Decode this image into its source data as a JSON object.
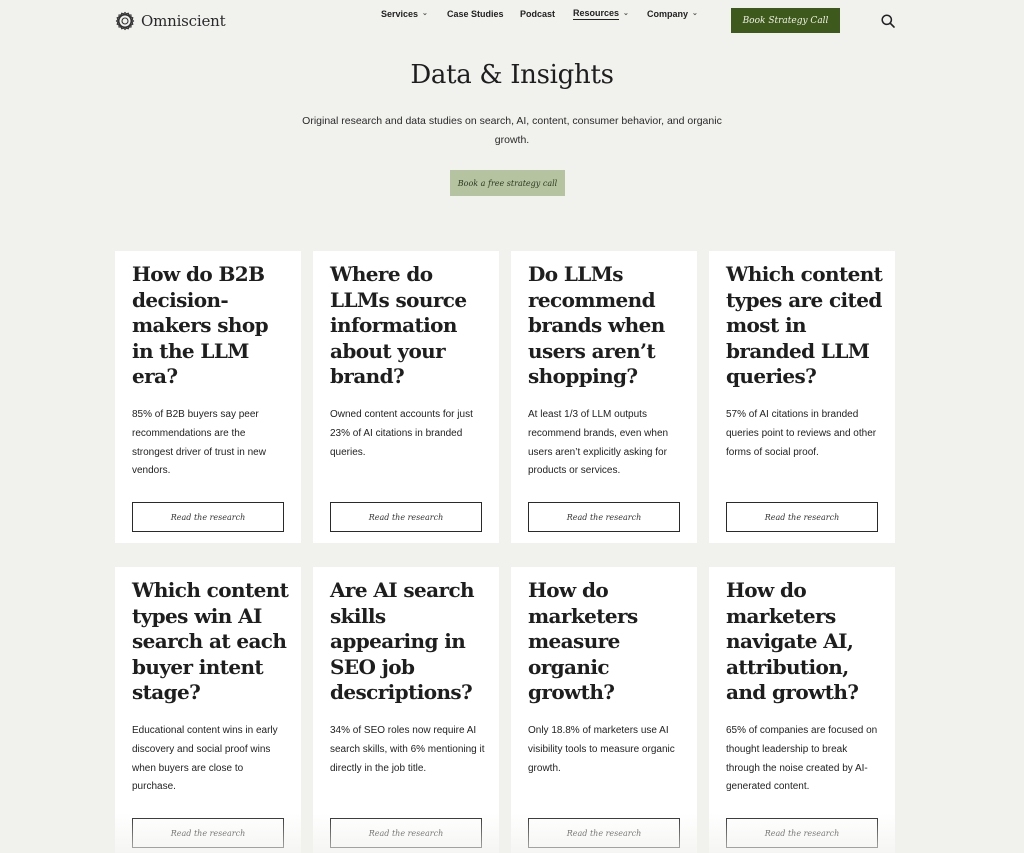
{
  "header": {
    "logo_text": "Omniscient",
    "nav": [
      {
        "label": "Services",
        "has_dropdown": true
      },
      {
        "label": "Case Studies",
        "has_dropdown": false
      },
      {
        "label": "Podcast",
        "has_dropdown": false
      },
      {
        "label": "Resources",
        "has_dropdown": true,
        "active": true
      },
      {
        "label": "Company",
        "has_dropdown": true
      }
    ],
    "cta_label": "Book Strategy Call",
    "search_icon": "search-icon"
  },
  "hero": {
    "title": "Data & Insights",
    "subtitle": "Original research and data studies on search, AI, content, consumer behavior, and organic growth.",
    "cta_label": "Book a free strategy call"
  },
  "cards": [
    {
      "title": "How do B2B decision-makers shop in the LLM era?",
      "description": "85% of B2B buyers say peer recommendations are the strongest driver of trust in new vendors.",
      "button_label": "Read the research"
    },
    {
      "title": "Where do LLMs source information about your brand?",
      "description": "Owned content accounts for just 23% of AI citations in branded queries.",
      "button_label": "Read the research"
    },
    {
      "title": "Do LLMs recommend brands when users aren’t shopping?",
      "description": "At least 1/3 of LLM outputs recommend brands, even when users aren’t explicitly asking for products or services.",
      "button_label": "Read the research"
    },
    {
      "title": "Which content types are cited most in branded LLM queries?",
      "description": "57% of AI citations in branded queries point to reviews and other forms of social proof.",
      "button_label": "Read the research"
    },
    {
      "title": "Which content types win AI search at each buyer intent stage?",
      "description": "Educational content wins in early discovery and social proof wins when buyers are close to purchase.",
      "button_label": "Read the research"
    },
    {
      "title": "Are AI search skills appearing in SEO job descriptions?",
      "description": "34% of SEO roles now require AI search skills, with 6% mentioning it directly in the job title.",
      "button_label": "Read the research"
    },
    {
      "title": "How do marketers measure organic growth?",
      "description": "Only 18.8% of marketers use AI visibility tools to measure organic growth.",
      "button_label": "Read the research"
    },
    {
      "title": "How do marketers navigate AI, attribution, and growth?",
      "description": "65% of companies are focused on thought leadership to break through the noise created by AI-generated content.",
      "button_label": "Read the research"
    }
  ],
  "colors": {
    "background": "#f1f1ee",
    "header_cta": "#3d5a1c",
    "hero_cta": "#b6c3a1",
    "card": "#ffffff"
  }
}
